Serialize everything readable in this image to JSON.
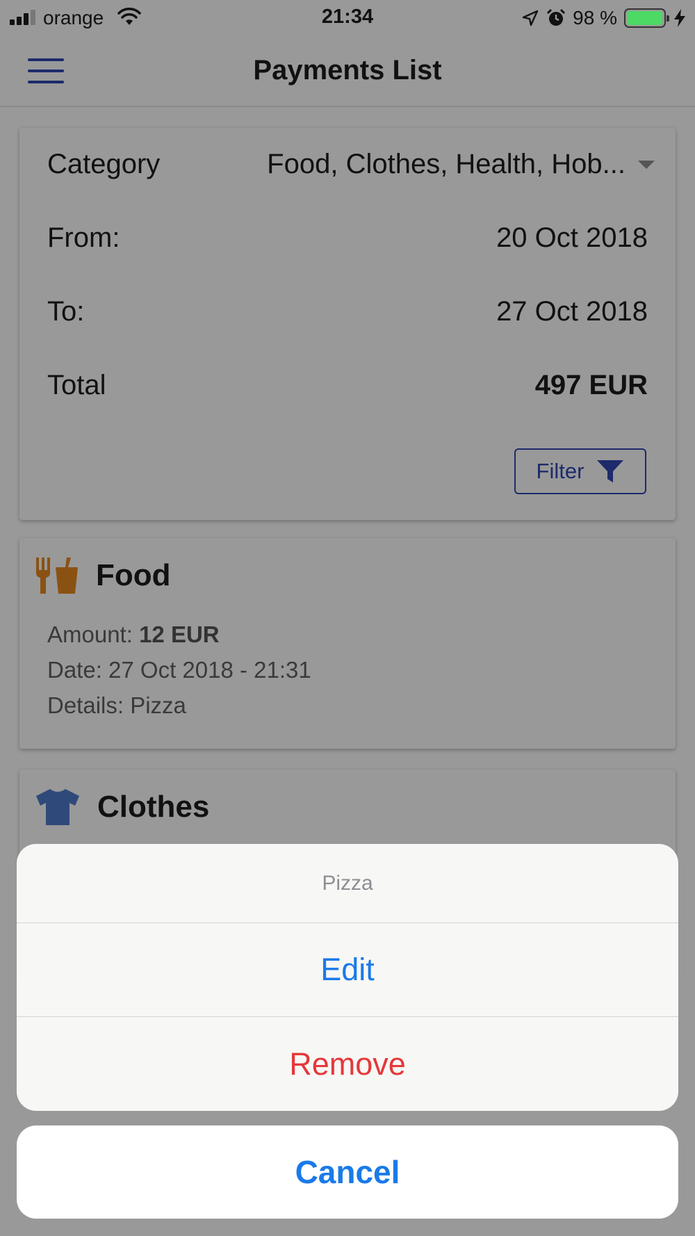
{
  "status_bar": {
    "carrier": "orange",
    "time": "21:34",
    "battery_percent": "98 %",
    "battery_level": 0.98,
    "icons": [
      "signal-icon",
      "wifi-icon",
      "location-icon",
      "alarm-icon",
      "battery-icon",
      "charging-icon"
    ]
  },
  "header": {
    "title": "Payments List",
    "menu_icon": "hamburger-menu-icon"
  },
  "filter": {
    "category_label": "Category",
    "category_value": "Food, Clothes, Health, Hob...",
    "from_label": "From:",
    "from_value": "20 Oct 2018",
    "to_label": "To:",
    "to_value": "27 Oct 2018",
    "total_label": "Total",
    "total_value": "497 EUR",
    "filter_button": "Filter",
    "filter_icon": "funnel-icon"
  },
  "payments": [
    {
      "category": "Food",
      "icon": "food-drink-icon",
      "amount_label": "Amount: ",
      "amount_value": "12 EUR",
      "date": "Date: 27 Oct 2018 - 21:31",
      "details": "Details: Pizza"
    },
    {
      "category": "Clothes",
      "icon": "tshirt-icon"
    }
  ],
  "action_sheet": {
    "title": "Pizza",
    "edit": "Edit",
    "remove": "Remove",
    "cancel": "Cancel"
  },
  "colors": {
    "accent_navy": "#1d2a6b",
    "ios_blue": "#1a7ae8",
    "destructive_red": "#e5383b",
    "food_icon": "#8a5212",
    "clothes_icon": "#2f4a7a",
    "battery_green": "#4cd964"
  }
}
